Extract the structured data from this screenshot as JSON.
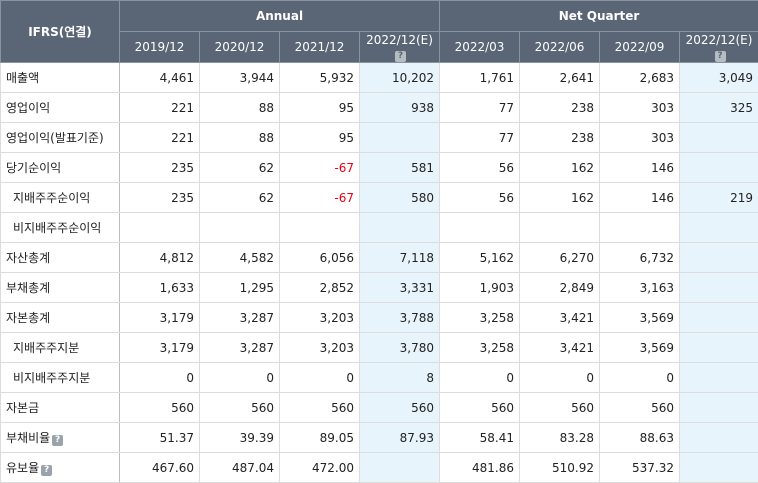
{
  "header": {
    "corner": "IFRS(연결)",
    "group_annual": "Annual",
    "group_quarter": "Net Quarter",
    "periods": [
      "2019/12",
      "2020/12",
      "2021/12",
      "2022/12(E)",
      "2022/03",
      "2022/06",
      "2022/09",
      "2022/12(E)"
    ]
  },
  "icons": {
    "help": "question-icon"
  },
  "rows": [
    {
      "label": "매출액",
      "values": [
        "4,461",
        "3,944",
        "5,932",
        "10,202",
        "1,761",
        "2,641",
        "2,683",
        "3,049"
      ]
    },
    {
      "label": "영업이익",
      "values": [
        "221",
        "88",
        "95",
        "938",
        "77",
        "238",
        "303",
        "325"
      ]
    },
    {
      "label": "영업이익(발표기준)",
      "values": [
        "221",
        "88",
        "95",
        "",
        "77",
        "238",
        "303",
        ""
      ]
    },
    {
      "label": "당기순이익",
      "values": [
        "235",
        "62",
        "-67",
        "581",
        "56",
        "162",
        "146",
        ""
      ]
    },
    {
      "label": "지배주주순이익",
      "values": [
        "235",
        "62",
        "-67",
        "580",
        "56",
        "162",
        "146",
        "219"
      ]
    },
    {
      "label": "비지배주주순이익",
      "values": [
        "",
        "",
        "",
        "",
        "",
        "",
        "",
        ""
      ]
    },
    {
      "label": "자산총계",
      "values": [
        "4,812",
        "4,582",
        "6,056",
        "7,118",
        "5,162",
        "6,270",
        "6,732",
        ""
      ]
    },
    {
      "label": "부채총계",
      "values": [
        "1,633",
        "1,295",
        "2,852",
        "3,331",
        "1,903",
        "2,849",
        "3,163",
        ""
      ]
    },
    {
      "label": "자본총계",
      "values": [
        "3,179",
        "3,287",
        "3,203",
        "3,788",
        "3,258",
        "3,421",
        "3,569",
        ""
      ]
    },
    {
      "label": "지배주주지분",
      "values": [
        "3,179",
        "3,287",
        "3,203",
        "3,780",
        "3,258",
        "3,421",
        "3,569",
        ""
      ]
    },
    {
      "label": "비지배주주지분",
      "values": [
        "0",
        "0",
        "0",
        "8",
        "0",
        "0",
        "0",
        ""
      ]
    },
    {
      "label": "자본금",
      "values": [
        "560",
        "560",
        "560",
        "560",
        "560",
        "560",
        "560",
        ""
      ]
    },
    {
      "label": "부채비율",
      "values": [
        "51.37",
        "39.39",
        "89.05",
        "87.93",
        "58.41",
        "83.28",
        "88.63",
        ""
      ]
    },
    {
      "label": "유보율",
      "values": [
        "467.60",
        "487.04",
        "472.00",
        "",
        "481.86",
        "510.92",
        "537.32",
        ""
      ]
    }
  ],
  "colors": {
    "header_bg": "#5a6675",
    "estimate_bg": "#e8f4fb",
    "negative": "#e60012"
  }
}
